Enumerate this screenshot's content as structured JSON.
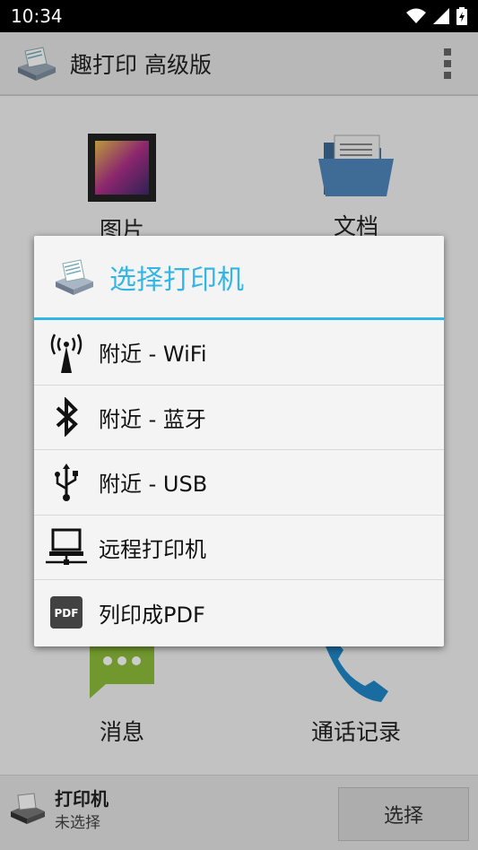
{
  "status_bar": {
    "time": "10:34"
  },
  "app_bar": {
    "title": "趣打印 高级版"
  },
  "tiles": {
    "pictures": "图片",
    "documents": "文档",
    "messages": "消息",
    "call_log": "通话记录"
  },
  "bottom_bar": {
    "printer_label": "打印机",
    "printer_status": "未选择",
    "select_label": "选择"
  },
  "dialog": {
    "title": "选择打印机",
    "options": [
      {
        "label": "附近 - WiFi",
        "icon": "wifi-antenna-icon"
      },
      {
        "label": "附近 - 蓝牙",
        "icon": "bluetooth-icon"
      },
      {
        "label": "附近 - USB",
        "icon": "usb-icon"
      },
      {
        "label": "远程打印机",
        "icon": "remote-computer-icon"
      },
      {
        "label": "列印成PDF",
        "icon": "pdf-icon"
      }
    ]
  },
  "colors": {
    "accent": "#33b5e5"
  }
}
